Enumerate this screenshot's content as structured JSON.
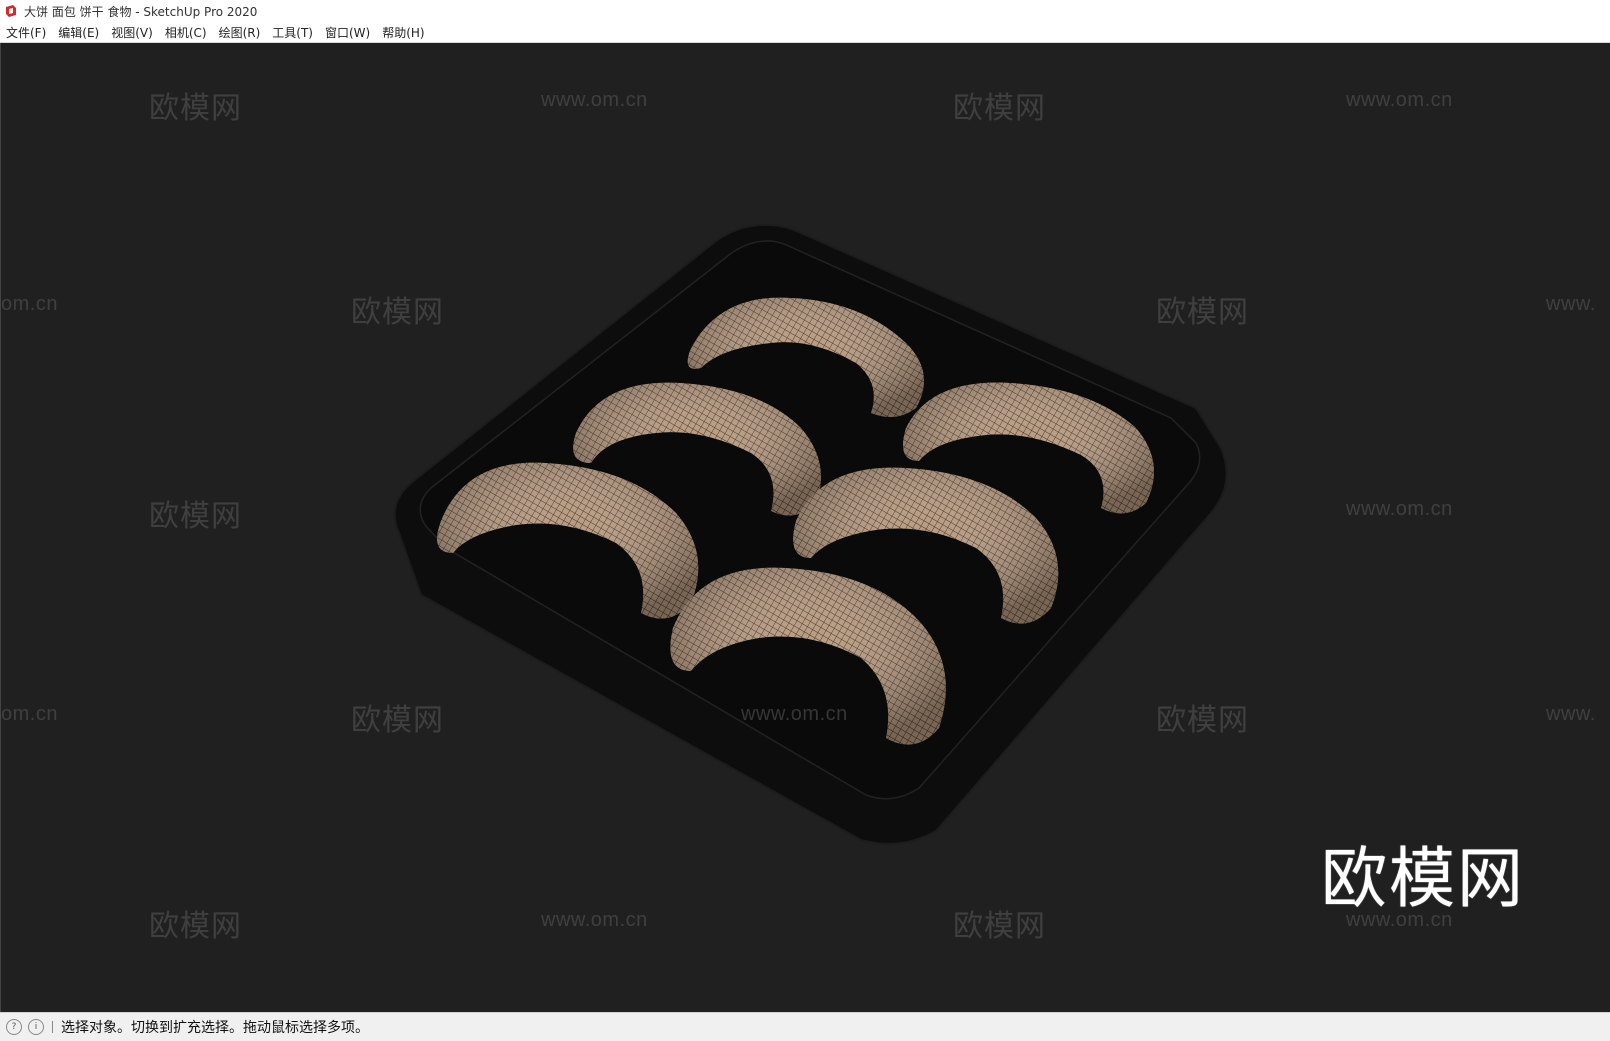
{
  "window": {
    "title": "大饼 面包 饼干 食物 - SketchUp Pro 2020"
  },
  "menu": [
    {
      "label": "文件(F)"
    },
    {
      "label": "编辑(E)"
    },
    {
      "label": "视图(V)"
    },
    {
      "label": "相机(C)"
    },
    {
      "label": "绘图(R)"
    },
    {
      "label": "工具(T)"
    },
    {
      "label": "窗口(W)"
    },
    {
      "label": "帮助(H)"
    }
  ],
  "watermarks": {
    "cn": "欧模网",
    "url": "www.om.cn",
    "url_partial_left": "om.cn",
    "url_partial_right": "www."
  },
  "logo": "欧模网",
  "status": {
    "message": "选择对象。切换到扩充选择。拖动鼠标选择多项。"
  },
  "colors": {
    "viewport_bg": "#202020",
    "tray": "#0b0b0b",
    "croissant": "#b89a7e"
  }
}
